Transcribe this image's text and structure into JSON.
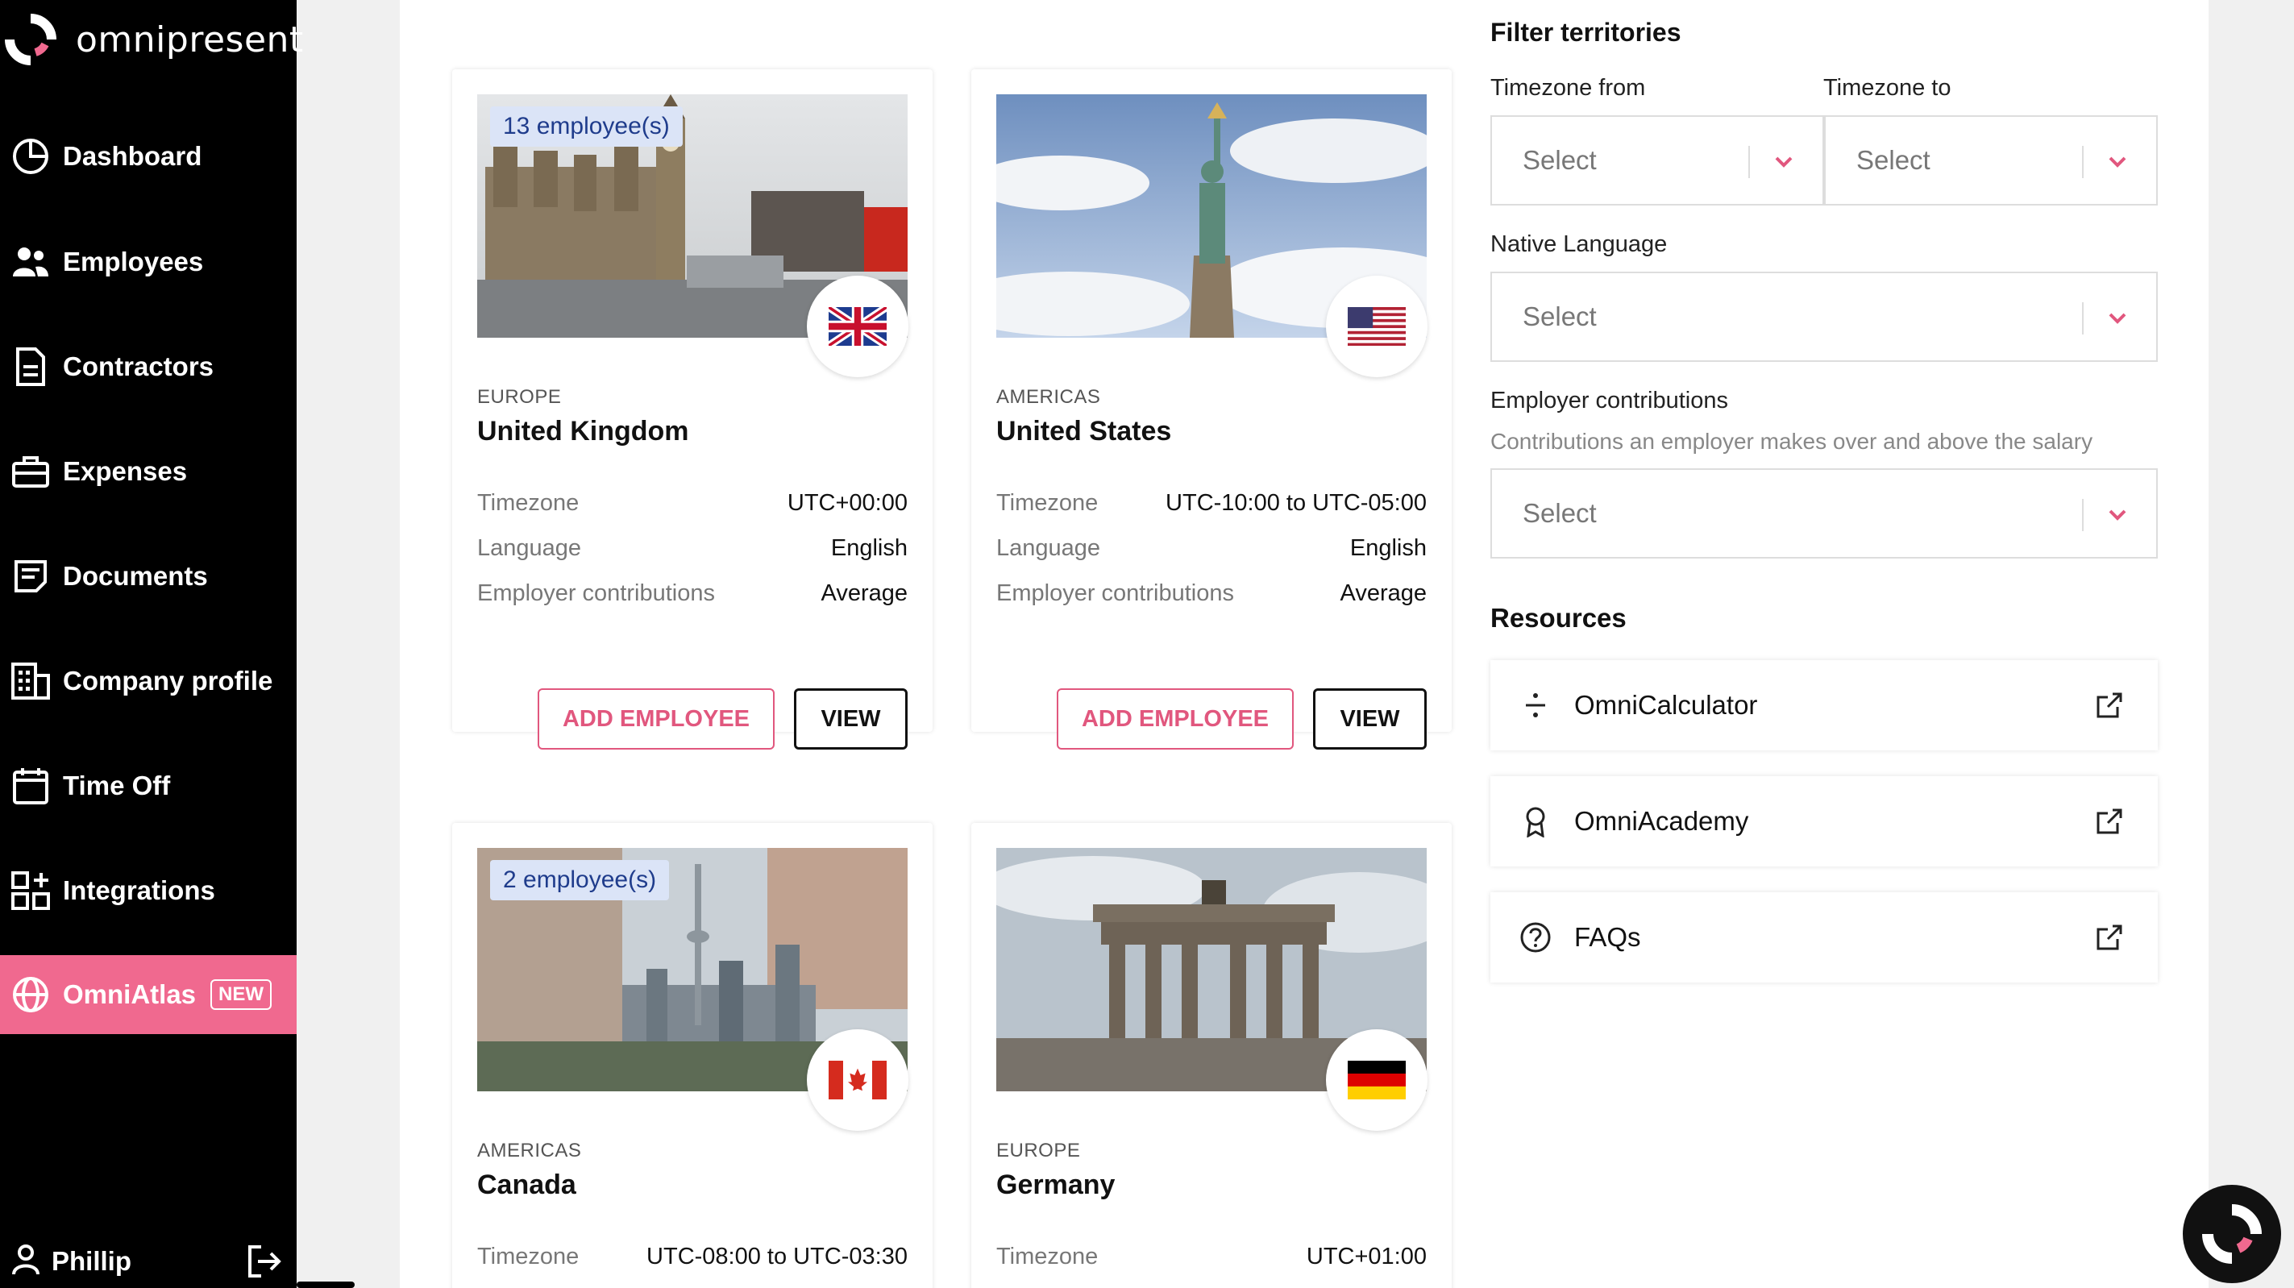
{
  "app": {
    "brand": "omnipresent",
    "accent_color": "#f0698f"
  },
  "sidebar": {
    "items": [
      {
        "label": "Dashboard",
        "icon": "pie-chart-icon"
      },
      {
        "label": "Employees",
        "icon": "users-icon"
      },
      {
        "label": "Contractors",
        "icon": "document-icon"
      },
      {
        "label": "Expenses",
        "icon": "briefcase-icon"
      },
      {
        "label": "Documents",
        "icon": "file-text-icon"
      },
      {
        "label": "Company profile",
        "icon": "building-icon"
      },
      {
        "label": "Time Off",
        "icon": "calendar-icon"
      },
      {
        "label": "Integrations",
        "icon": "grid-plus-icon"
      },
      {
        "label": "OmniAtlas",
        "icon": "globe-icon",
        "badge": "NEW",
        "active": true
      }
    ],
    "user": {
      "name": "Phillip"
    }
  },
  "cards": [
    {
      "employees": "13 employee(s)",
      "region": "EUROPE",
      "country": "United Kingdom",
      "flag": "uk-flag-icon",
      "timezone_label": "Timezone",
      "timezone": "UTC+00:00",
      "language_label": "Language",
      "language": "English",
      "contrib_label": "Employer contributions",
      "contrib": "Average",
      "add_label": "ADD EMPLOYEE",
      "view_label": "VIEW"
    },
    {
      "employees": "",
      "region": "AMERICAS",
      "country": "United States",
      "flag": "us-flag-icon",
      "timezone_label": "Timezone",
      "timezone": "UTC-10:00 to UTC-05:00",
      "language_label": "Language",
      "language": "English",
      "contrib_label": "Employer contributions",
      "contrib": "Average",
      "add_label": "ADD EMPLOYEE",
      "view_label": "VIEW"
    },
    {
      "employees": "2 employee(s)",
      "region": "AMERICAS",
      "country": "Canada",
      "flag": "canada-flag-icon",
      "timezone_label": "Timezone",
      "timezone": "UTC-08:00 to UTC-03:30"
    },
    {
      "employees": "",
      "region": "EUROPE",
      "country": "Germany",
      "flag": "germany-flag-icon",
      "timezone_label": "Timezone",
      "timezone": "UTC+01:00"
    }
  ],
  "filters": {
    "title": "Filter territories",
    "tz_from_label": "Timezone from",
    "tz_to_label": "Timezone to",
    "native_language_label": "Native Language",
    "contrib_label": "Employer contributions",
    "contrib_help": "Contributions an employer makes over and above the salary",
    "select_placeholder": "Select"
  },
  "resources": {
    "title": "Resources",
    "items": [
      {
        "label": "OmniCalculator",
        "icon": "divide-icon"
      },
      {
        "label": "OmniAcademy",
        "icon": "award-icon"
      },
      {
        "label": "FAQs",
        "icon": "help-circle-icon"
      }
    ]
  }
}
